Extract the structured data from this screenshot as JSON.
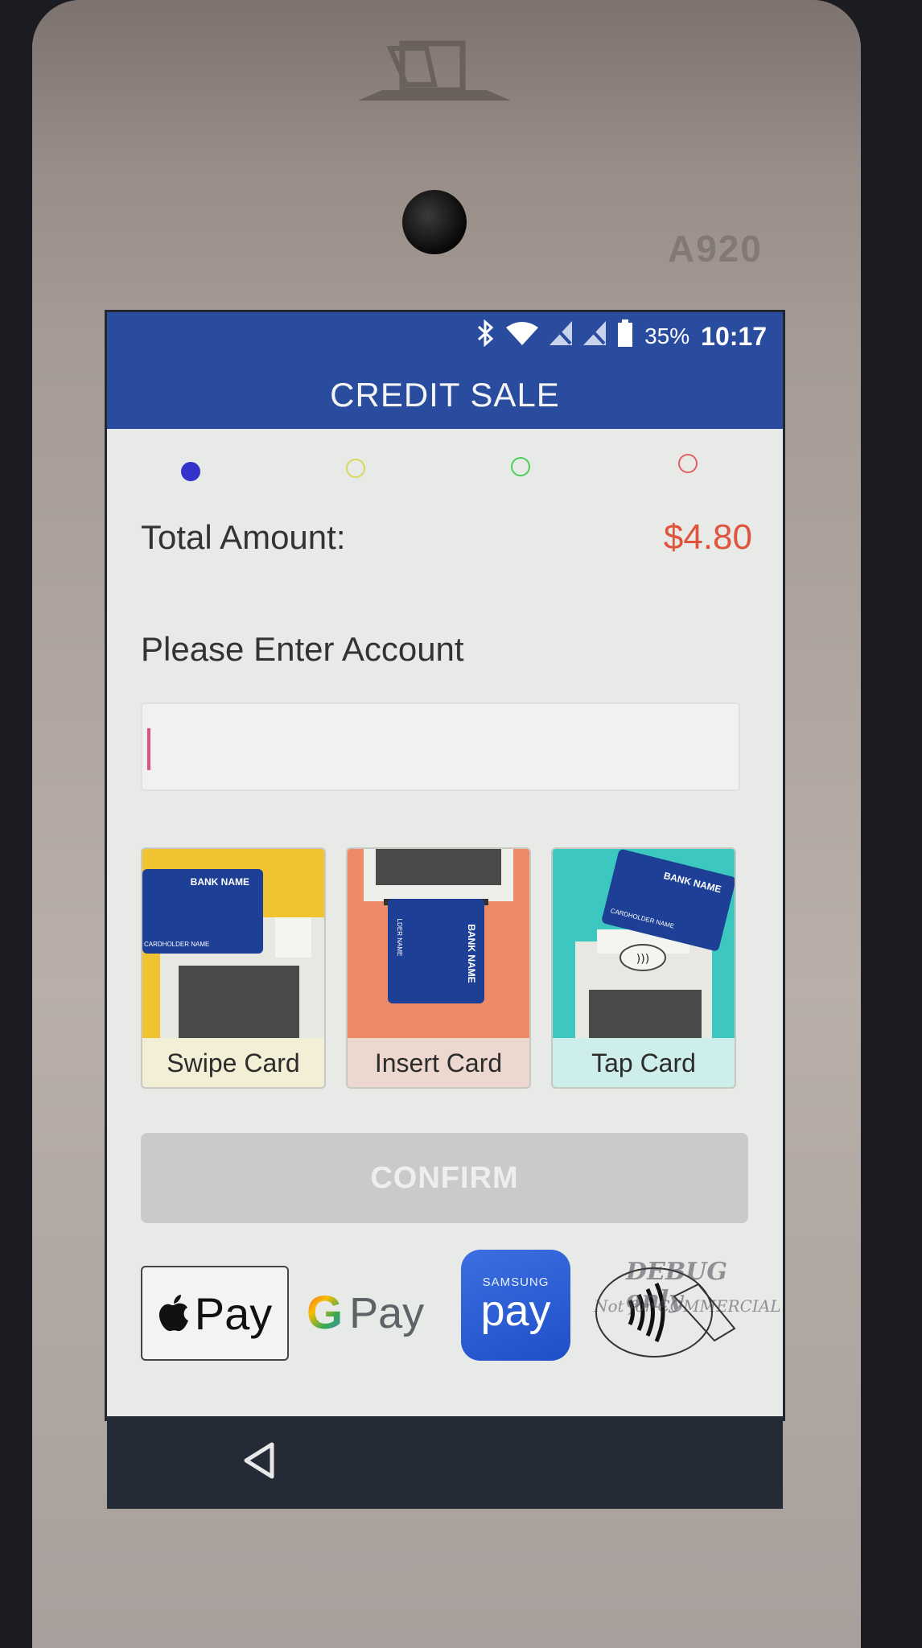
{
  "device": {
    "model_label": "A920"
  },
  "status_bar": {
    "battery_percent": "35%",
    "clock": "10:17",
    "icons": [
      "bluetooth-icon",
      "wifi-icon",
      "no-sim-icon",
      "no-sim-icon",
      "battery-icon"
    ]
  },
  "header": {
    "title": "CREDIT SALE"
  },
  "steps": {
    "colors": [
      "#3333cc",
      "#d8d85a",
      "#4ccf5a",
      "#e06060"
    ],
    "active_index": 0
  },
  "sale": {
    "total_label": "Total Amount:",
    "total_value": "$4.80",
    "account_label": "Please Enter Account",
    "account_value": ""
  },
  "card_options": [
    {
      "label": "Swipe Card",
      "card_text": "BANK NAME",
      "holder_text": "CARDHOLDER NAME",
      "bg": "#f2c331"
    },
    {
      "label": "Insert Card",
      "card_text": "BANK NAME",
      "holder_text": "LDER NAME",
      "bg": "#ee8a68"
    },
    {
      "label": "Tap Card",
      "card_text": "BANK NAME",
      "holder_text": "CARDHOLDER NAME",
      "bg": "#3cc8c0"
    }
  ],
  "confirm": {
    "label": "CONFIRM"
  },
  "payment_methods": {
    "apple_pay_text": "Pay",
    "google_pay_text": "Pay",
    "google_letter": "G",
    "samsung_small": "SAMSUNG",
    "samsung_big": "pay",
    "debug_line1": "DEBUG only",
    "debug_line2": "Not for COMMERCIAL"
  },
  "colors": {
    "header_blue": "#2a4c9e",
    "amount_red": "#e0533d"
  }
}
